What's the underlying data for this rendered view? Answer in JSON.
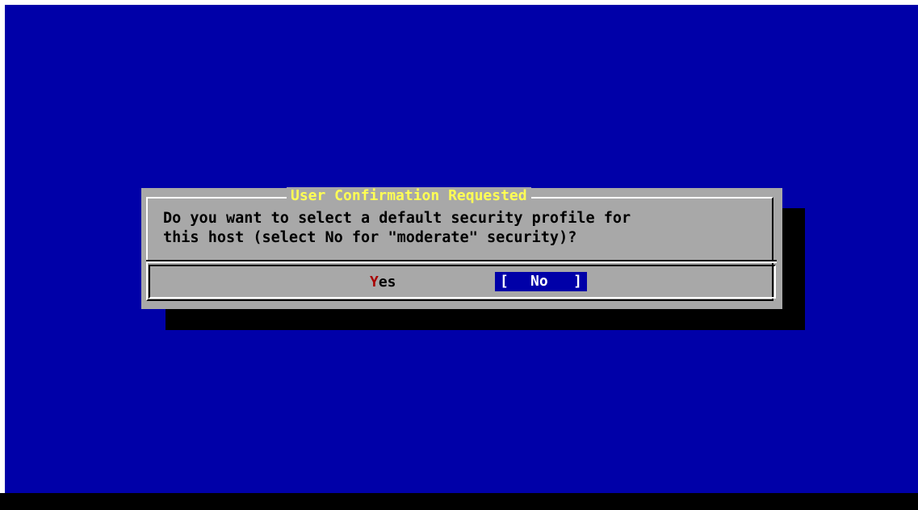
{
  "screen": {
    "background": "#0000a8"
  },
  "dialog": {
    "title": "User Confirmation Requested",
    "message_line_1": "Do you want to select a default security profile for",
    "message_line_2": "this host (select No for \"moderate\" security)?",
    "title_color": "#ffff54",
    "background": "#a8a8a8"
  },
  "buttons": {
    "yes": {
      "hotkey": "Y",
      "rest": "es",
      "hotkey_color": "#a80000",
      "selected": false
    },
    "no": {
      "open_bracket": "[",
      "hotkey": "N",
      "rest": "o",
      "close_bracket": "]",
      "selected": true,
      "highlight_color": "#0000a8"
    }
  }
}
